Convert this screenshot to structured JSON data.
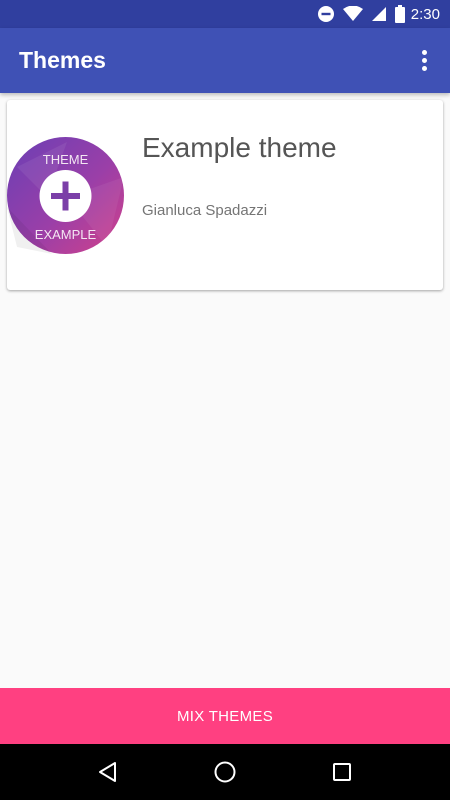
{
  "status_bar": {
    "time": "2:30",
    "icons": [
      "do-not-disturb-icon",
      "wifi-icon",
      "signal-icon",
      "battery-icon"
    ]
  },
  "app_bar": {
    "title": "Themes",
    "overflow_icon": "more-vert-icon"
  },
  "themes": [
    {
      "title": "Example theme",
      "author": "Gianluca Spadazzi",
      "logo": {
        "top_text": "THEME",
        "bottom_text": "EXAMPLE",
        "gradient": [
          "#7b3fb0",
          "#c2408f"
        ]
      }
    }
  ],
  "mix_button": {
    "label": "MIX THEMES",
    "color": "#ff4081"
  },
  "colors": {
    "primary": "#3f51b5",
    "primary_dark": "#303f9f",
    "accent": "#ff4081"
  },
  "nav_bar": {
    "icons": [
      "back-icon",
      "home-icon",
      "recents-icon"
    ]
  }
}
